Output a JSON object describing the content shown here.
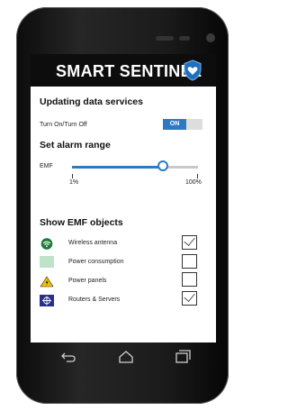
{
  "app": {
    "title": "SMART SENTINEL",
    "brand_color": "#2e79c4"
  },
  "updating": {
    "heading": "Updating data services",
    "toggle_label": "Turn On/Turn Off",
    "toggle_state": "ON"
  },
  "alarm": {
    "heading": "Set alarm range",
    "slider_label": "EMF",
    "min_label": "1%",
    "max_label": "100%",
    "value_percent": 72
  },
  "emf": {
    "heading": "Show EMF objects",
    "items": [
      {
        "label": "Wireless antenna",
        "icon": "wifi-icon",
        "checked": true
      },
      {
        "label": "Power consumption",
        "icon": "power-consumption-icon",
        "checked": false
      },
      {
        "label": "Power panels",
        "icon": "warning-icon",
        "checked": false
      },
      {
        "label": "Routers & Servers",
        "icon": "router-icon",
        "checked": true
      }
    ]
  },
  "nav": {
    "back_icon": "back-icon",
    "home_icon": "home-icon",
    "recents_icon": "recents-icon"
  }
}
